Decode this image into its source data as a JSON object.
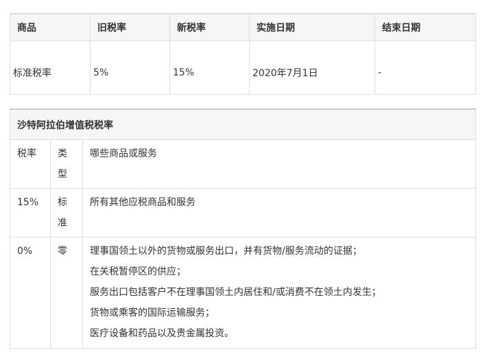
{
  "table1": {
    "headers": [
      "商品",
      "旧税率",
      "新税率",
      "实施日期",
      "结束日期"
    ],
    "row": [
      "标准税率",
      "5%",
      "15%",
      "2020年7月1日",
      "-"
    ]
  },
  "table2": {
    "title": "沙特阿拉伯增值税税率",
    "header_row": {
      "rate": "税率",
      "type_line1": "类",
      "type_line2": "型",
      "desc": "哪些商品或服务"
    },
    "rows": [
      {
        "rate": "15%",
        "type_line1": "标",
        "type_line2": "准",
        "desc": [
          "所有其他应税商品和服务"
        ]
      },
      {
        "rate": "0%",
        "type_line1": "零",
        "type_line2": "",
        "desc": [
          "理事国领土以外的货物或服务出口，并有货物/服务流动的证据；",
          "在关税暂停区的供应；",
          "服务出口包括客户不在理事国领土内居住和/或消费不在领土内发生；",
          "货物或乘客的国际运输服务；",
          "医疗设备和药品以及贵金属投资。"
        ]
      }
    ]
  }
}
